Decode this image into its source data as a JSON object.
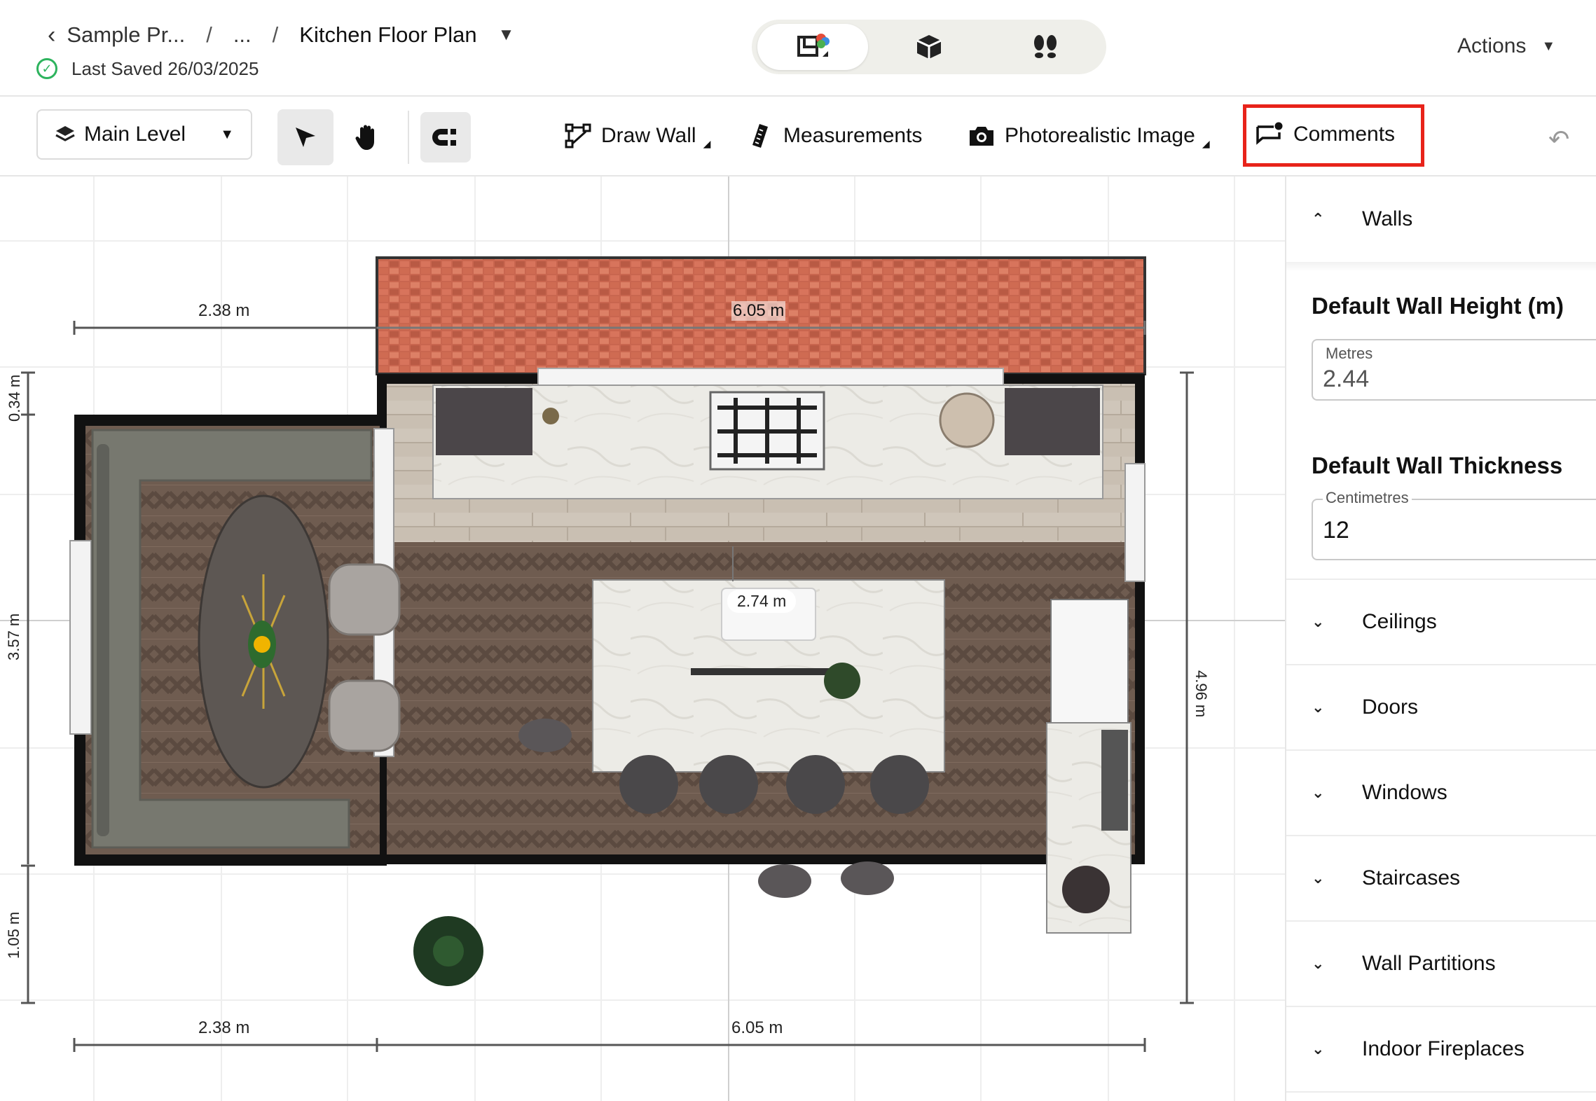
{
  "header": {
    "breadcrumb_project": "Sample Pr...",
    "breadcrumb_sep1": "/",
    "breadcrumb_ellipsis": "...",
    "breadcrumb_sep2": "/",
    "plan_title": "Kitchen Floor Plan",
    "last_saved": "Last Saved 26/03/2025",
    "actions_label": "Actions",
    "view_modes": [
      "2d-plan-icon",
      "3d-box-icon",
      "walkthrough-footsteps-icon"
    ],
    "active_view": "2d-plan-icon"
  },
  "toolbar": {
    "level_label": "Main Level",
    "tools": {
      "draw_wall": "Draw Wall",
      "measurements": "Measurements",
      "photorealistic": "Photorealistic Image",
      "comments": "Comments"
    },
    "highlighted_tool": "Comments"
  },
  "canvas": {
    "dimensions": {
      "top_left": "2.38 m",
      "top_right": "6.05 m",
      "left_034": "0.34 m",
      "left_357": "3.57 m",
      "left_105": "1.05 m",
      "right_496": "4.96 m",
      "bottom_left": "2.38 m",
      "bottom_right": "6.05 m",
      "island": "2.74 m"
    }
  },
  "panel": {
    "walls_title": "Walls",
    "wall_height_title": "Default Wall Height (m)",
    "wall_height_unit": "Metres",
    "wall_height_value": "2.44",
    "wall_thickness_title": "Default Wall Thickness",
    "wall_thickness_unit": "Centimetres",
    "wall_thickness_value": "12",
    "sections": [
      "Ceilings",
      "Doors",
      "Windows",
      "Staircases",
      "Wall Partitions",
      "Indoor Fireplaces"
    ]
  },
  "colors": {
    "accent_highlight": "#e8231a",
    "saved_ok": "#2db35d",
    "brick": "#c9664f",
    "parquet": "#6f5c50"
  }
}
